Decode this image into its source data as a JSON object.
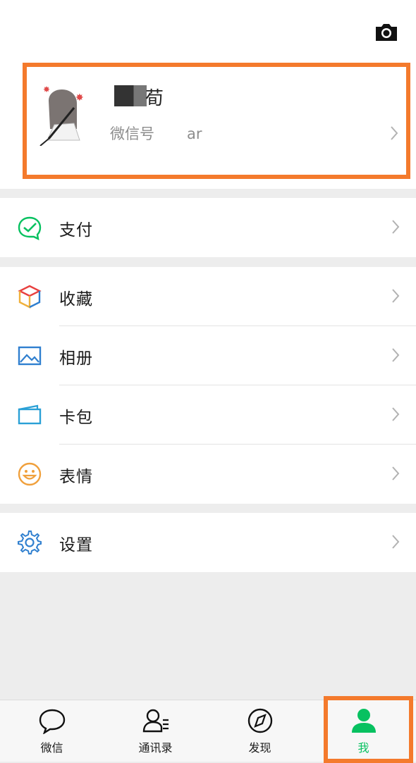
{
  "profile": {
    "name_partial": "荀",
    "wechat_id_label": "微信号",
    "wechat_id_partial": "ar"
  },
  "menu": {
    "pay": {
      "label": "支付",
      "icon": "pay-check-icon",
      "color": "#07c160"
    },
    "favorites": {
      "label": "收藏",
      "icon": "favorites-cube-icon"
    },
    "album": {
      "label": "相册",
      "icon": "album-picture-icon",
      "color": "#2f7fcf"
    },
    "cards": {
      "label": "卡包",
      "icon": "card-wallet-icon",
      "color": "#2aa0d6"
    },
    "stickers": {
      "label": "表情",
      "icon": "smiley-icon",
      "color": "#f0a03c"
    },
    "settings": {
      "label": "设置",
      "icon": "gear-icon",
      "color": "#2f7fcf"
    }
  },
  "tabbar": {
    "tabs": [
      {
        "label": "微信",
        "icon": "chat-bubble-icon",
        "active": false
      },
      {
        "label": "通讯录",
        "icon": "contacts-icon",
        "active": false
      },
      {
        "label": "发现",
        "icon": "compass-icon",
        "active": false
      },
      {
        "label": "我",
        "icon": "me-person-icon",
        "active": true
      }
    ],
    "active_color": "#07c160"
  },
  "highlight_color": "#f47a2c"
}
